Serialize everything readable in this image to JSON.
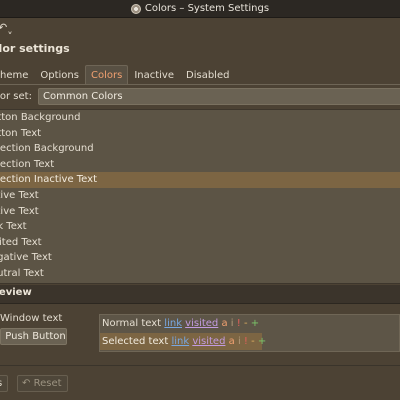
{
  "window": {
    "title": "Colors – System Settings"
  },
  "page": {
    "nav_icon": "↶ˬ",
    "title": "olor settings"
  },
  "tabs": [
    {
      "label": "heme",
      "active": false
    },
    {
      "label": "Options",
      "active": false
    },
    {
      "label": "Colors",
      "active": true
    },
    {
      "label": "Inactive",
      "active": false
    },
    {
      "label": "Disabled",
      "active": false
    }
  ],
  "color_set": {
    "label": "olor set:",
    "value": "Common Colors"
  },
  "color_roles": [
    "utton Background",
    "utton Text",
    "election Background",
    "election Text",
    "election Inactive Text",
    "ctive Text",
    "ctive Text",
    "nk Text",
    "isited Text",
    "egative Text",
    "eutral Text"
  ],
  "selected_role_index": 4,
  "preview": {
    "title": "review",
    "window_text": "Window text",
    "push_button": "Push Button",
    "normal_row": {
      "label": "Normal text",
      "link": "link",
      "visited": "visited",
      "a": "a",
      "i": "i",
      "n": "!",
      "ne": "-",
      "p": "+"
    },
    "selected_row": {
      "label": "Selected text",
      "link": "link",
      "visited": "visited",
      "a": "a",
      "i": "i",
      "n": "!",
      "ne": "-",
      "p": "+"
    }
  },
  "bottom": {
    "defaults_label": "s",
    "reset_icon": "↶",
    "reset_label": "Reset"
  },
  "colors": {
    "accent": "#7c6543",
    "background": "#4c4234",
    "link": "#78a7e0",
    "visited": "#c29be0",
    "negative": "#e0605a",
    "neutral": "#e0b060",
    "positive": "#7bc66a"
  }
}
